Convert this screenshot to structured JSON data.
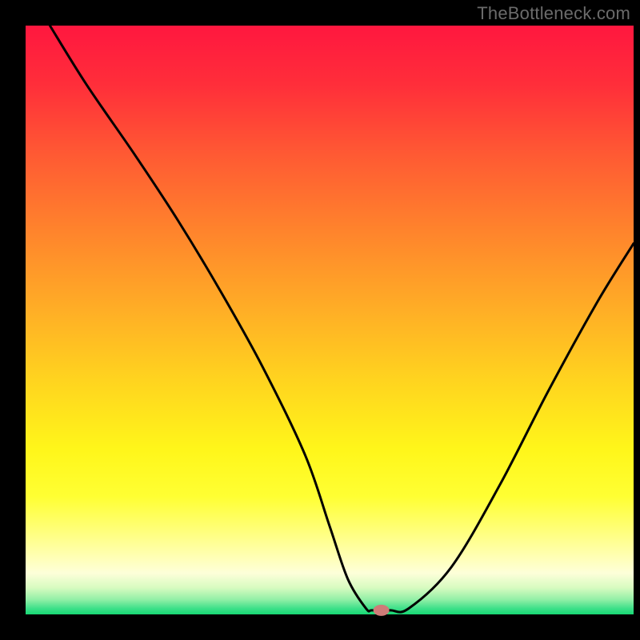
{
  "watermark": "TheBottleneck.com",
  "chart_data": {
    "type": "line",
    "title": "",
    "xlabel": "",
    "ylabel": "",
    "xlim": [
      0,
      100
    ],
    "ylim": [
      0,
      100
    ],
    "series": [
      {
        "name": "bottleneck-curve",
        "x": [
          4,
          10,
          18,
          25,
          32,
          39,
          46,
          50,
          53,
          56,
          57,
          60,
          63,
          70,
          78,
          86,
          94,
          100
        ],
        "values": [
          100,
          90,
          78,
          67,
          55,
          42,
          27,
          15,
          6,
          1,
          0.7,
          0.7,
          1,
          8,
          22,
          38,
          53,
          63
        ]
      }
    ],
    "marker": {
      "x": 58.5,
      "y": 0.7,
      "color": "#cf7b78"
    },
    "background": {
      "type": "vertical-gradient",
      "stops": [
        {
          "pos": 0.0,
          "color": "#ff173f"
        },
        {
          "pos": 0.1,
          "color": "#ff2e3a"
        },
        {
          "pos": 0.22,
          "color": "#ff5a33"
        },
        {
          "pos": 0.35,
          "color": "#ff842c"
        },
        {
          "pos": 0.48,
          "color": "#ffad26"
        },
        {
          "pos": 0.6,
          "color": "#ffd31f"
        },
        {
          "pos": 0.72,
          "color": "#fff61a"
        },
        {
          "pos": 0.8,
          "color": "#ffff33"
        },
        {
          "pos": 0.86,
          "color": "#ffff7d"
        },
        {
          "pos": 0.905,
          "color": "#ffffb8"
        },
        {
          "pos": 0.93,
          "color": "#fdffd9"
        },
        {
          "pos": 0.955,
          "color": "#d7fbc0"
        },
        {
          "pos": 0.975,
          "color": "#91efa6"
        },
        {
          "pos": 0.99,
          "color": "#3de089"
        },
        {
          "pos": 1.0,
          "color": "#18d873"
        }
      ]
    }
  }
}
